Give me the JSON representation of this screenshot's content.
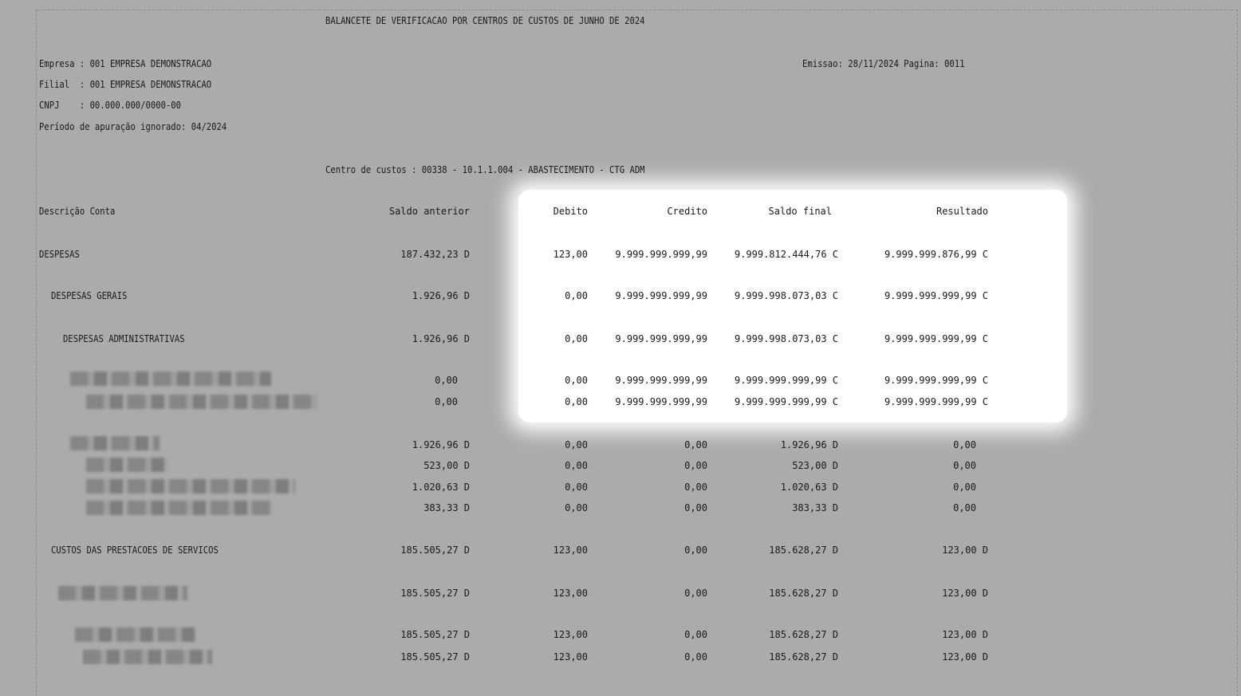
{
  "report": {
    "title": "BALANCETE DE VERIFICACAO POR CENTROS DE CUSTOS DE JUNHO DE 2024",
    "empresa": "Empresa : 001 EMPRESA DEMONSTRACAO",
    "filial": "Filial  : 001 EMPRESA DEMONSTRACAO",
    "cnpj": "CNPJ    : 00.000.000/0000-00",
    "periodo": "Período de apuração ignorado: 04/2024",
    "emissao": "Emissao: 28/11/2024 Pagina: 0011",
    "centro_custos": "Centro de custos : 00338 - 10.1.1.004 - ABASTECIMENTO - CTG ADM"
  },
  "columns": {
    "descricao": "Descrição Conta",
    "saldo_anterior": "Saldo anterior",
    "debito": "Debito",
    "credito": "Credito",
    "saldo_final": "Saldo final",
    "resultado": "Resultado"
  },
  "rows": [
    {
      "desc": "DESPESAS",
      "saldo_anterior": "187.432,23 D",
      "debito": "123,00",
      "credito": "9.999.999.999,99",
      "saldo_final": "9.999.812.444,76 C",
      "resultado": "9.999.999.876,99 C"
    },
    {
      "desc": "DESPESAS GERAIS",
      "saldo_anterior": "1.926,96 D",
      "debito": "0,00",
      "credito": "9.999.999.999,99",
      "saldo_final": "9.999.998.073,03 C",
      "resultado": "9.999.999.999,99 C"
    },
    {
      "desc": "DESPESAS ADMINISTRATIVAS",
      "saldo_anterior": "1.926,96 D",
      "debito": "0,00",
      "credito": "9.999.999.999,99",
      "saldo_final": "9.999.998.073,03 C",
      "resultado": "9.999.999.999,99 C"
    },
    {
      "desc": "",
      "saldo_anterior": "0,00",
      "debito": "0,00",
      "credito": "9.999.999.999,99",
      "saldo_final": "9.999.999.999,99 C",
      "resultado": "9.999.999.999,99 C"
    },
    {
      "desc": "",
      "saldo_anterior": "0,00",
      "debito": "0,00",
      "credito": "9.999.999.999,99",
      "saldo_final": "9.999.999.999,99 C",
      "resultado": "9.999.999.999,99 C"
    },
    {
      "desc": "",
      "saldo_anterior": "1.926,96 D",
      "debito": "0,00",
      "credito": "0,00",
      "saldo_final": "1.926,96 D",
      "resultado": "0,00"
    },
    {
      "desc": "",
      "saldo_anterior": "523,00 D",
      "debito": "0,00",
      "credito": "0,00",
      "saldo_final": "523,00 D",
      "resultado": "0,00"
    },
    {
      "desc": "",
      "saldo_anterior": "1.020,63 D",
      "debito": "0,00",
      "credito": "0,00",
      "saldo_final": "1.020,63 D",
      "resultado": "0,00"
    },
    {
      "desc": "",
      "saldo_anterior": "383,33 D",
      "debito": "0,00",
      "credito": "0,00",
      "saldo_final": "383,33 D",
      "resultado": "0,00"
    },
    {
      "desc": "CUSTOS DAS PRESTACOES DE SERVICOS",
      "saldo_anterior": "185.505,27 D",
      "debito": "123,00",
      "credito": "0,00",
      "saldo_final": "185.628,27 D",
      "resultado": "123,00 D"
    },
    {
      "desc": "",
      "saldo_anterior": "185.505,27 D",
      "debito": "123,00",
      "credito": "0,00",
      "saldo_final": "185.628,27 D",
      "resultado": "123,00 D"
    },
    {
      "desc": "",
      "saldo_anterior": "185.505,27 D",
      "debito": "123,00",
      "credito": "0,00",
      "saldo_final": "185.628,27 D",
      "resultado": "123,00 D"
    },
    {
      "desc": "",
      "saldo_anterior": "185.505,27 D",
      "debito": "123,00",
      "credito": "0,00",
      "saldo_final": "185.628,27 D",
      "resultado": "123,00 D"
    }
  ]
}
